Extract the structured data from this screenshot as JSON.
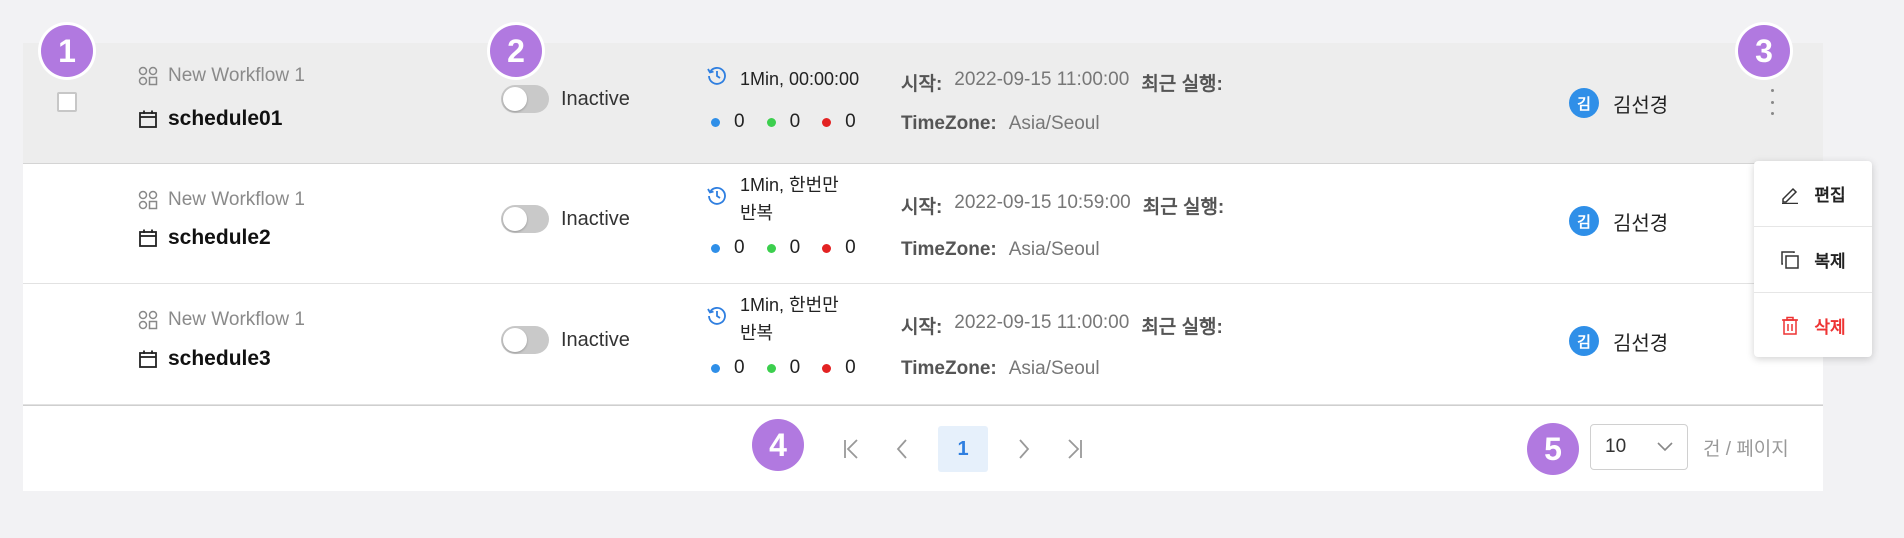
{
  "rows": [
    {
      "workflow": "New Workflow 1",
      "schedule": "schedule01",
      "status": "Inactive",
      "interval_line1": "1Min, 00:00:00",
      "interval_line2": "",
      "counts": [
        "0",
        "0",
        "0"
      ],
      "start_label": "시작:",
      "start": "2022-09-15 11:00:00",
      "last_run_label": "최근 실행:",
      "tz_label": "TimeZone:",
      "tz": "Asia/Seoul",
      "owner_initial": "김",
      "owner": "김선경"
    },
    {
      "workflow": "New Workflow 1",
      "schedule": "schedule2",
      "status": "Inactive",
      "interval_line1": "1Min, 한번만",
      "interval_line2": "반복",
      "counts": [
        "0",
        "0",
        "0"
      ],
      "start_label": "시작:",
      "start": "2022-09-15 10:59:00",
      "last_run_label": "최근 실행:",
      "tz_label": "TimeZone:",
      "tz": "Asia/Seoul",
      "owner_initial": "김",
      "owner": "김선경"
    },
    {
      "workflow": "New Workflow 1",
      "schedule": "schedule3",
      "status": "Inactive",
      "interval_line1": "1Min, 한번만",
      "interval_line2": "반복",
      "counts": [
        "0",
        "0",
        "0"
      ],
      "start_label": "시작:",
      "start": "2022-09-15 11:00:00",
      "last_run_label": "최근 실행:",
      "tz_label": "TimeZone:",
      "tz": "Asia/Seoul",
      "owner_initial": "김",
      "owner": "김선경"
    }
  ],
  "menu": {
    "edit": "편집",
    "duplicate": "복제",
    "delete": "삭제"
  },
  "pagination": {
    "current": "1",
    "page_size": "10",
    "page_size_suffix": "건 / 페이지"
  },
  "badges": [
    "1",
    "2",
    "3",
    "4",
    "5"
  ],
  "colors": {
    "dot_blue": "#2f8fe8",
    "dot_green": "#3ccf4e",
    "dot_red": "#e32222",
    "accent": "#2f7fe0",
    "badge": "#b179e0",
    "delete": "#e33333"
  },
  "icons": {
    "workflow": "workflow-icon",
    "calendar": "calendar-icon",
    "clock": "history-clock-icon",
    "edit": "pencil-icon",
    "duplicate": "copy-icon",
    "delete": "trash-icon"
  }
}
